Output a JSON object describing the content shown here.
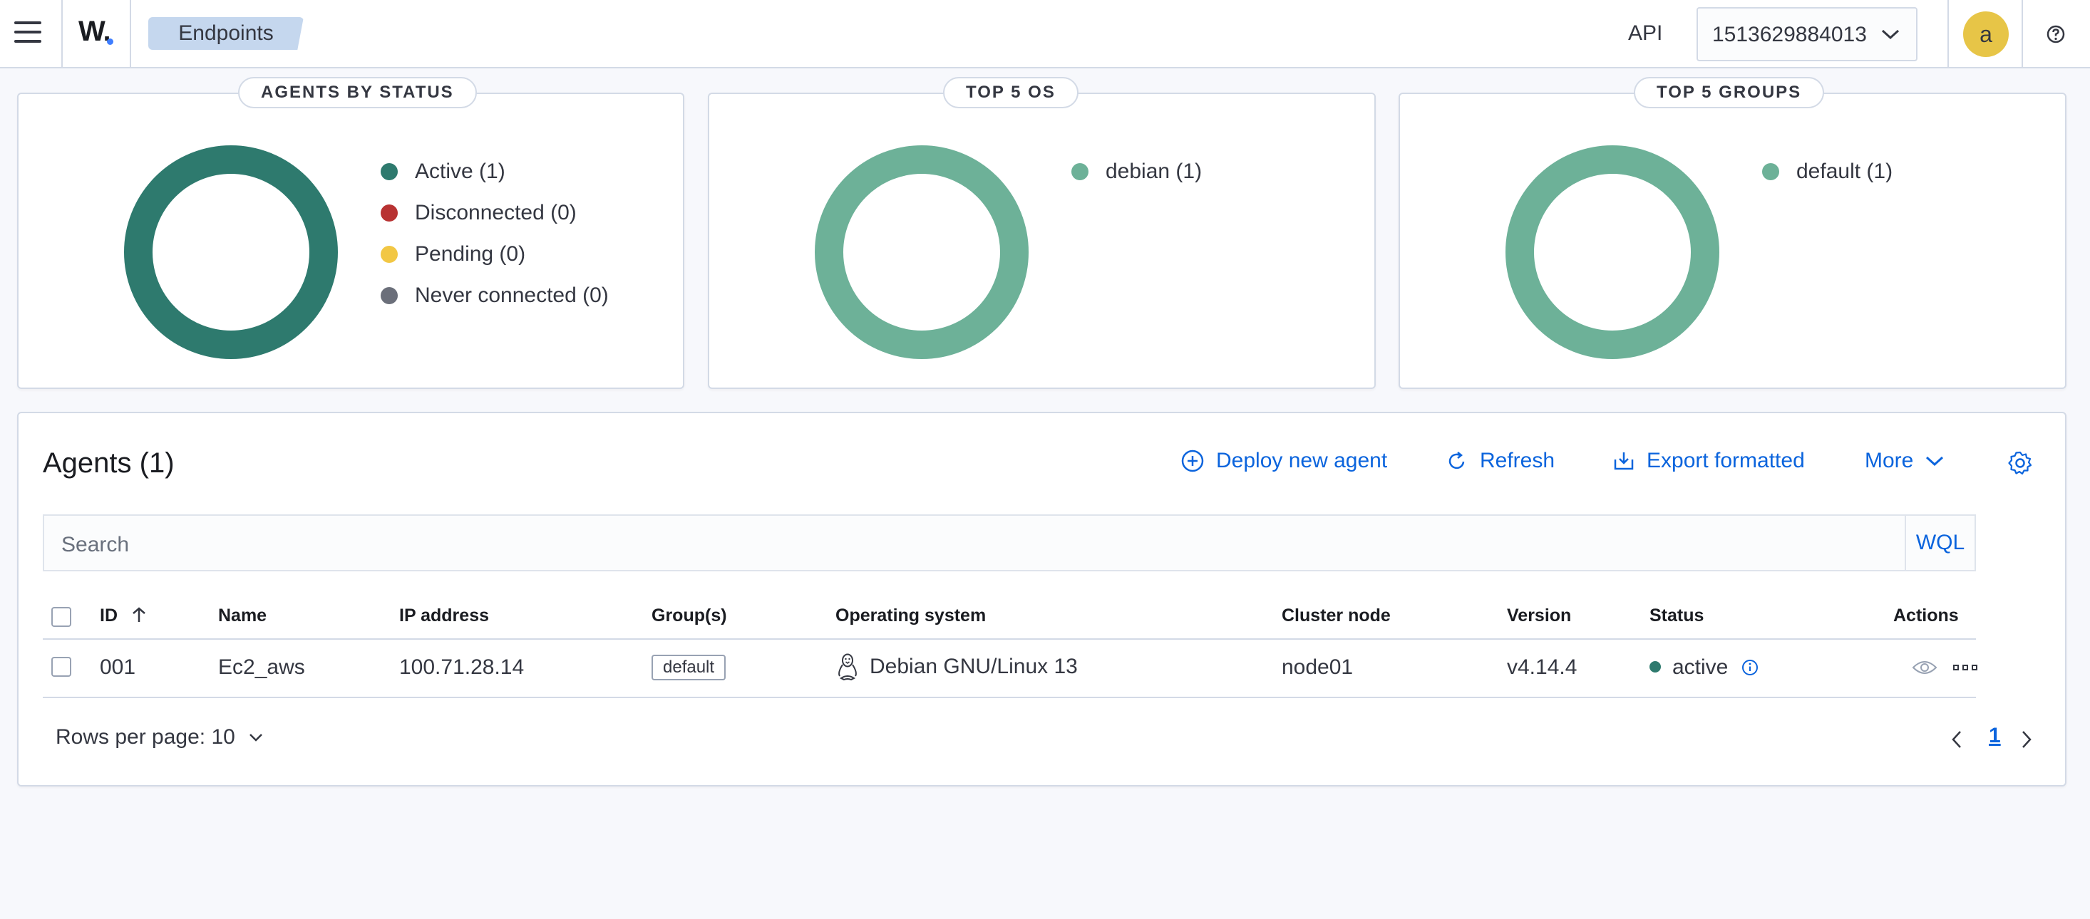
{
  "header": {
    "logo": "W.",
    "breadcrumb": "Endpoints",
    "api_label": "API",
    "api_selected": "1513629884013",
    "avatar_letter": "a"
  },
  "summary_cards": {
    "status": {
      "title": "AGENTS BY STATUS",
      "legend": [
        {
          "label": "Active (1)",
          "color": "#2e7a6e",
          "value": 1
        },
        {
          "label": "Disconnected (0)",
          "color": "#b83232",
          "value": 0
        },
        {
          "label": "Pending (0)",
          "color": "#f2c744",
          "value": 0
        },
        {
          "label": "Never connected (0)",
          "color": "#6b6f7a",
          "value": 0
        }
      ]
    },
    "os": {
      "title": "TOP 5 OS",
      "legend": [
        {
          "label": "debian (1)",
          "color": "#6db198",
          "value": 1
        }
      ]
    },
    "groups": {
      "title": "TOP 5 GROUPS",
      "legend": [
        {
          "label": "default (1)",
          "color": "#6db198",
          "value": 1
        }
      ]
    }
  },
  "agents": {
    "title": "Agents (1)",
    "actions": {
      "deploy": "Deploy new agent",
      "refresh": "Refresh",
      "export": "Export formatted",
      "more": "More"
    },
    "search_placeholder": "Search",
    "wql_label": "WQL",
    "columns": [
      "ID",
      "Name",
      "IP address",
      "Group(s)",
      "Operating system",
      "Cluster node",
      "Version",
      "Status",
      "Actions"
    ],
    "rows": [
      {
        "id": "001",
        "name": "Ec2_aws",
        "ip": "100.71.28.14",
        "group": "default",
        "os": "Debian GNU/Linux 13",
        "cluster_node": "node01",
        "version": "v4.14.4",
        "status": "active"
      }
    ],
    "rows_per_page": "Rows per page: 10",
    "current_page": "1"
  },
  "colors": {
    "accent": "#0b64dd",
    "active": "#2e7a6e",
    "chart_light": "#6db198"
  }
}
